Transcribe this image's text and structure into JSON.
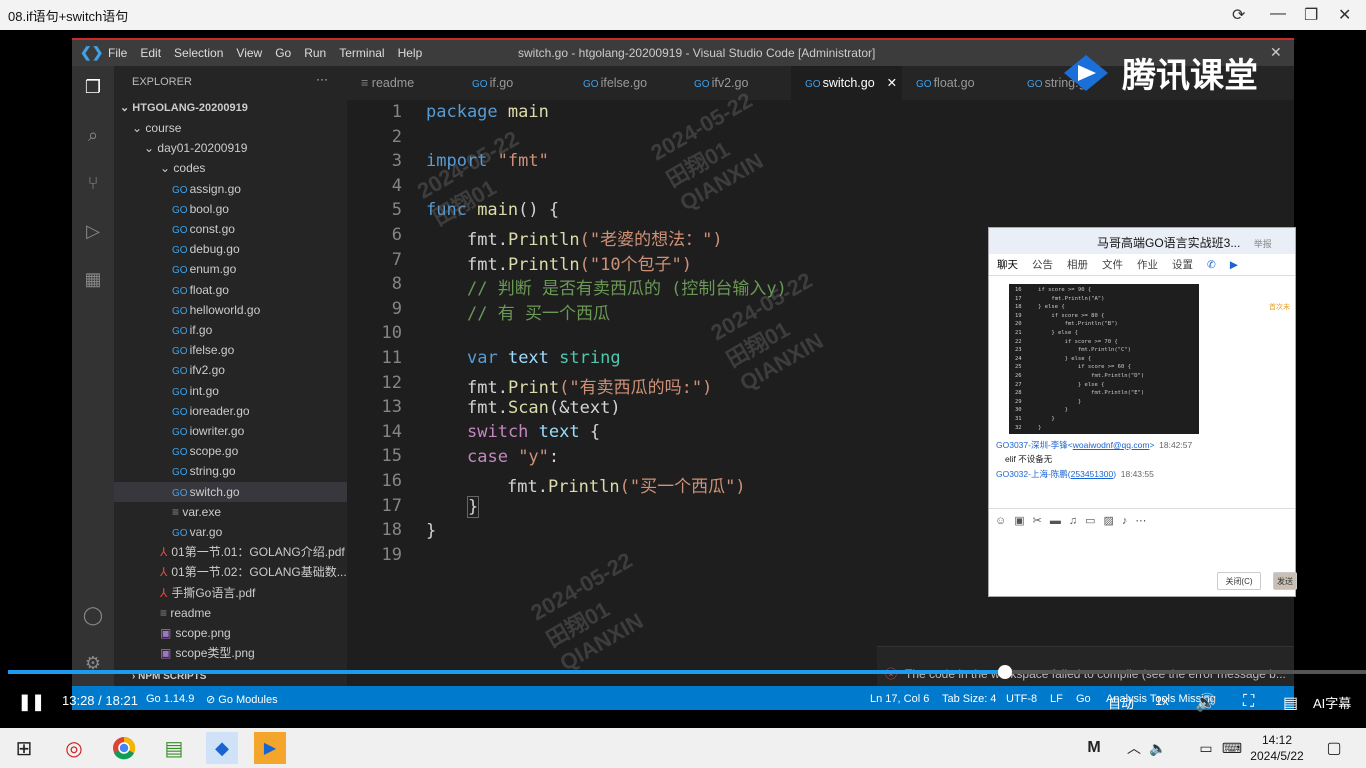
{
  "player": {
    "title": "08.if语句+switch语句",
    "current_time": "13:28",
    "total_time": "18:21",
    "progress_percent": 73.4,
    "auto_label": "自动",
    "speed_label": "1x",
    "subtitle_label": "AI字幕"
  },
  "vscode": {
    "menu": [
      "File",
      "Edit",
      "Selection",
      "View",
      "Go",
      "Run",
      "Terminal",
      "Help"
    ],
    "window_title": "switch.go - htgolang-20200919 - Visual Studio Code [Administrator]",
    "explorer_header": "EXPLORER",
    "root_folder": "HTGOLANG-20200919",
    "tree": [
      {
        "label": "course",
        "type": "folder",
        "level": 1
      },
      {
        "label": "day01-20200919",
        "type": "folder",
        "level": 2
      },
      {
        "label": "codes",
        "type": "folder",
        "level": 3
      },
      {
        "label": "assign.go",
        "type": "go",
        "level": 4
      },
      {
        "label": "bool.go",
        "type": "go",
        "level": 4
      },
      {
        "label": "const.go",
        "type": "go",
        "level": 4
      },
      {
        "label": "debug.go",
        "type": "go",
        "level": 4
      },
      {
        "label": "enum.go",
        "type": "go",
        "level": 4
      },
      {
        "label": "float.go",
        "type": "go",
        "level": 4
      },
      {
        "label": "helloworld.go",
        "type": "go",
        "level": 4
      },
      {
        "label": "if.go",
        "type": "go",
        "level": 4
      },
      {
        "label": "ifelse.go",
        "type": "go",
        "level": 4
      },
      {
        "label": "ifv2.go",
        "type": "go",
        "level": 4
      },
      {
        "label": "int.go",
        "type": "go",
        "level": 4
      },
      {
        "label": "ioreader.go",
        "type": "go",
        "level": 4
      },
      {
        "label": "iowriter.go",
        "type": "go",
        "level": 4
      },
      {
        "label": "scope.go",
        "type": "go",
        "level": 4
      },
      {
        "label": "string.go",
        "type": "go",
        "level": 4
      },
      {
        "label": "switch.go",
        "type": "go",
        "level": 4,
        "selected": true
      },
      {
        "label": "var.exe",
        "type": "file",
        "level": 4
      },
      {
        "label": "var.go",
        "type": "go",
        "level": 4
      },
      {
        "label": "01第一节.01：GOLANG介绍.pdf",
        "type": "pdf",
        "level": 3
      },
      {
        "label": "01第一节.02：GOLANG基础数...",
        "type": "pdf",
        "level": 3
      },
      {
        "label": "手撕Go语言.pdf",
        "type": "pdf",
        "level": 3
      },
      {
        "label": "readme",
        "type": "text",
        "level": 3
      },
      {
        "label": "scope.png",
        "type": "img",
        "level": 3
      },
      {
        "label": "scope类型.png",
        "type": "img",
        "level": 3
      }
    ],
    "npm_scripts": "NPM SCRIPTS",
    "tabs": [
      "readme",
      "if.go",
      "ifelse.go",
      "ifv2.go",
      "switch.go",
      "float.go",
      "string.go"
    ],
    "active_tab": "switch.go",
    "line_numbers": [
      "1",
      "2",
      "3",
      "4",
      "5",
      "6",
      "7",
      "8",
      "9",
      "10",
      "11",
      "12",
      "13",
      "14",
      "15",
      "16",
      "17",
      "18",
      "19"
    ],
    "code": {
      "l1_kw": "package",
      "l1_name": " main",
      "l3_kw": "import",
      "l3_str": " \"fmt\"",
      "l5_kw": "func",
      "l5_fn": " main",
      "l5_rest": "() {",
      "l6_pkg": "fmt.",
      "l6_fn": "Println",
      "l6_str": "(\"老婆的想法：\")",
      "l7_pkg": "fmt.",
      "l7_fn": "Println",
      "l7_str": "(\"10个包子\")",
      "l8_cm": "// 判断 是否有卖西瓜的 (控制台输入y)",
      "l9_cm": "// 有 买一个西瓜",
      "l11_kw": "var",
      "l11_var": " text",
      "l11_typ": " string",
      "l12_pkg": "fmt.",
      "l12_fn": "Print",
      "l12_str": "(\"有卖西瓜的吗:\")",
      "l13_pkg": "fmt.",
      "l13_fn": "Scan",
      "l13_rest": "(&text)",
      "l14_ctl": "switch",
      "l14_var": " text",
      "l14_rest": " {",
      "l15_ctl": "case",
      "l15_str": " \"y\"",
      "l15_rest": ":",
      "l16_pkg": "fmt.",
      "l16_fn": "Println",
      "l16_str": "(\"买一个西瓜\")",
      "l17": "}",
      "l18": "}"
    },
    "status": {
      "go_version": "Go 1.14.9",
      "modules": "Go Modules",
      "position": "Ln 17, Col 6",
      "tab_size": "Tab Size: 4",
      "encoding": "UTF-8",
      "eol": "LF",
      "lang": "Go",
      "analysis": "Analysis Tools Missing"
    },
    "error_toast": "The code in the workspace failed to compile (see the error message b..."
  },
  "watermark": {
    "brand": "腾讯课堂",
    "date": "2024-05-22",
    "name": "田翔01",
    "code": "QIANXIN"
  },
  "chat": {
    "title": "马哥高端GO语言实战班3...",
    "title_extra": "举报",
    "tabs": [
      "聊天",
      "公告",
      "相册",
      "文件",
      "作业",
      "设置"
    ],
    "code_lines": [
      "16     if score >= 90 {",
      "17         fmt.Println(\"A\")",
      "18     } else {",
      "19         if score >= 80 {",
      "20             fmt.Println(\"B\")",
      "21         } else {",
      "22             if score >= 70 {",
      "23                 fmt.Println(\"C\")",
      "24             } else {",
      "25                 if score >= 60 {",
      "26                     fmt.Println(\"D\")",
      "27                 } else {",
      "28                     fmt.Println(\"E\")",
      "29                 }",
      "30             }",
      "31         }",
      "32     }"
    ],
    "msg1_sender": "GO3037-深圳-李锋",
    "msg1_email": "woaiwodnf@qq.com",
    "msg1_time": "18:42:57",
    "msg1_text": "elif 不设备无",
    "msg2_sender": "GO3032-上海-陈鹏",
    "msg2_qq": "253451300",
    "msg2_time": "18:43:55",
    "close_btn": "关闭(C)",
    "send_btn": "发送",
    "side_label": "首次未"
  },
  "taskbar": {
    "time": "14:12",
    "date": "2024/5/22"
  }
}
